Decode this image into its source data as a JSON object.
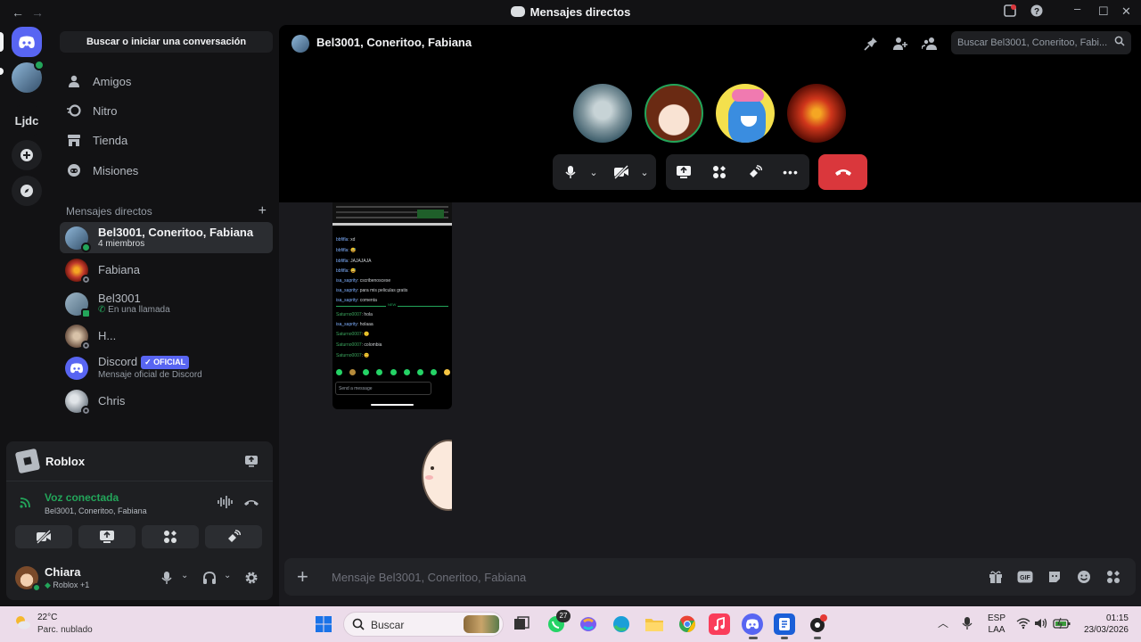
{
  "window": {
    "title": "Mensajes directos",
    "back": "←",
    "forward": "→"
  },
  "rail": {
    "server_label": "Ljdc"
  },
  "sidebar": {
    "search_label": "Buscar o iniciar una conversación",
    "nav": [
      {
        "label": "Amigos",
        "icon": "friends-icon"
      },
      {
        "label": "Nitro",
        "icon": "nitro-icon"
      },
      {
        "label": "Tienda",
        "icon": "shop-icon"
      },
      {
        "label": "Misiones",
        "icon": "quests-icon"
      }
    ],
    "dm_header": "Mensajes directos",
    "dms": [
      {
        "name": "Bel3001, Coneritoo, Fabiana",
        "sub": "4 miembros",
        "avatar_color": "#5a86ad",
        "status": "on"
      },
      {
        "name": "Fabiana",
        "sub": "",
        "avatar_color": "#c0392b",
        "status": "off"
      },
      {
        "name": "Bel3001",
        "sub": "En una llamada",
        "avatar_color": "#6b8aa3",
        "status": "on"
      },
      {
        "name": "H...",
        "sub": "",
        "avatar_color": "#8a6d5a",
        "status": "off"
      },
      {
        "name": "Discord",
        "badge": "✓ OFICIAL",
        "sub": "Mensaje oficial de Discord",
        "avatar_color": "#5865f2",
        "status": "none"
      },
      {
        "name": "Chris",
        "sub": "",
        "avatar_color": "#9aa2aa",
        "status": "off"
      }
    ]
  },
  "panel": {
    "activity_name": "Roblox",
    "voice_title": "Voz conectada",
    "voice_channel": "Bel3001, Coneritoo, Fabiana",
    "user_name": "Chiara",
    "user_status": "Roblox +1"
  },
  "call": {
    "title": "Bel3001, Coneritoo, Fabiana",
    "search_placeholder": "Buscar Bel3001, Coneritoo, Fabi...",
    "participants": [
      {
        "name": "seal",
        "color": "#6e8fa0"
      },
      {
        "name": "anime-girl",
        "color": "#7a3b1f"
      },
      {
        "name": "blue-creature",
        "color": "#f4e04d"
      },
      {
        "name": "red-flower",
        "color": "#8a1d0e"
      }
    ]
  },
  "phone_chat": {
    "lines": [
      {
        "user": "bbfifla",
        "text": "xd",
        "color": "blue"
      },
      {
        "user": "bbfifla",
        "text": "😅",
        "color": "blue"
      },
      {
        "user": "bbfifla",
        "text": "JAJAJAJA",
        "color": "blue"
      },
      {
        "user": "bbfifla",
        "text": "😅",
        "color": "blue"
      },
      {
        "user": "isa_saprity",
        "text": "cscribenoscese",
        "color": "blue"
      },
      {
        "user": "isa_saprity",
        "text": "para mis peliculas gratis",
        "color": "blue"
      },
      {
        "user": "isa_saprity",
        "text": "comenta",
        "color": "blue"
      },
      {
        "user": "Saturno0007",
        "text": "hola",
        "color": "green"
      },
      {
        "user": "isa_saprity",
        "text": "holaaa",
        "color": "blue"
      },
      {
        "user": "Saturno0007",
        "text": "🙂",
        "color": "green"
      },
      {
        "user": "Saturno0007",
        "text": "colombia",
        "color": "green"
      },
      {
        "user": "Saturno0007",
        "text": "😊",
        "color": "green"
      }
    ],
    "new_label": "NEW",
    "input_placeholder": "Send a message"
  },
  "composer": {
    "placeholder": "Mensaje Bel3001, Coneritoo, Fabiana"
  },
  "taskbar": {
    "temperature": "22°C",
    "condition": "Parc. nublado",
    "search": "Buscar",
    "badge_count": "27",
    "lang_top": "ESP",
    "lang_bottom": "LAA",
    "time": "01:15",
    "date": "23/03/2026"
  }
}
